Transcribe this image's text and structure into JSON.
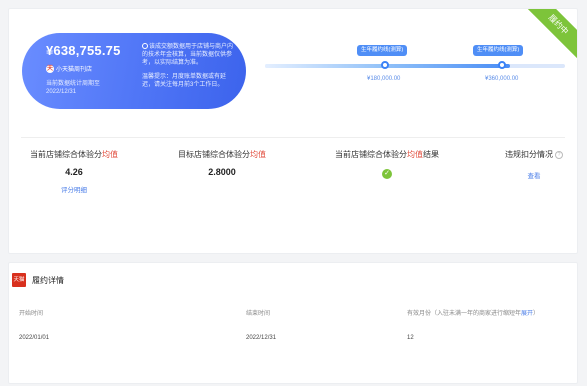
{
  "badge": {
    "status_label": "履约中",
    "color": "#7dc43a"
  },
  "summary": {
    "amount": "¥638,755.75",
    "shop_logo_text": "天",
    "shop_name": "小天猫周刊店",
    "note_line1": "当前数据统计周期至",
    "note_line2": "2022/12/31",
    "desc": "该成交额数据用于店铺与商户内的技术年金核算，当前数据仅供参考，以实际结算为准。",
    "hint": "温馨提示：月度账单数据或有延迟，请关注每月前3个工作日。",
    "gradient_colors": [
      "#6a8dff",
      "#3c63ec"
    ]
  },
  "progress": {
    "fill_fraction": 0.815,
    "milestones": [
      {
        "tip": "生年履约线(测算)",
        "value": "¥180,000.00",
        "fraction": 0.4
      },
      {
        "tip": "生年履约线(测算)",
        "value": "¥360,000.00",
        "fraction": 0.79
      }
    ]
  },
  "metrics": [
    {
      "label_prefix": "当前店铺综合体验分",
      "label_accent": "均值",
      "label_suffix": "",
      "value": "4.26",
      "link": "评分明细"
    },
    {
      "label_prefix": "目标店铺综合体验分",
      "label_accent": "均值",
      "label_suffix": "",
      "value": "2.8000"
    },
    {
      "label_prefix": "当前店铺综合体验分",
      "label_accent": "均值",
      "label_suffix": "结果",
      "status_icon": "check-circle-icon"
    },
    {
      "label_prefix": "违规扣分情况",
      "link": "查看",
      "info_icon": "question-icon"
    }
  ],
  "detail": {
    "logo_text": "天猫",
    "title": "履约详情",
    "columns": [
      {
        "label": "开始时间",
        "value": "2022/01/01"
      },
      {
        "label": "结束时间",
        "value": "2022/12/31"
      },
      {
        "label": "有效月份（入驻未满一年的商家进行缩短年",
        "link": "展开",
        "label_end": "）",
        "value": "12"
      }
    ]
  }
}
